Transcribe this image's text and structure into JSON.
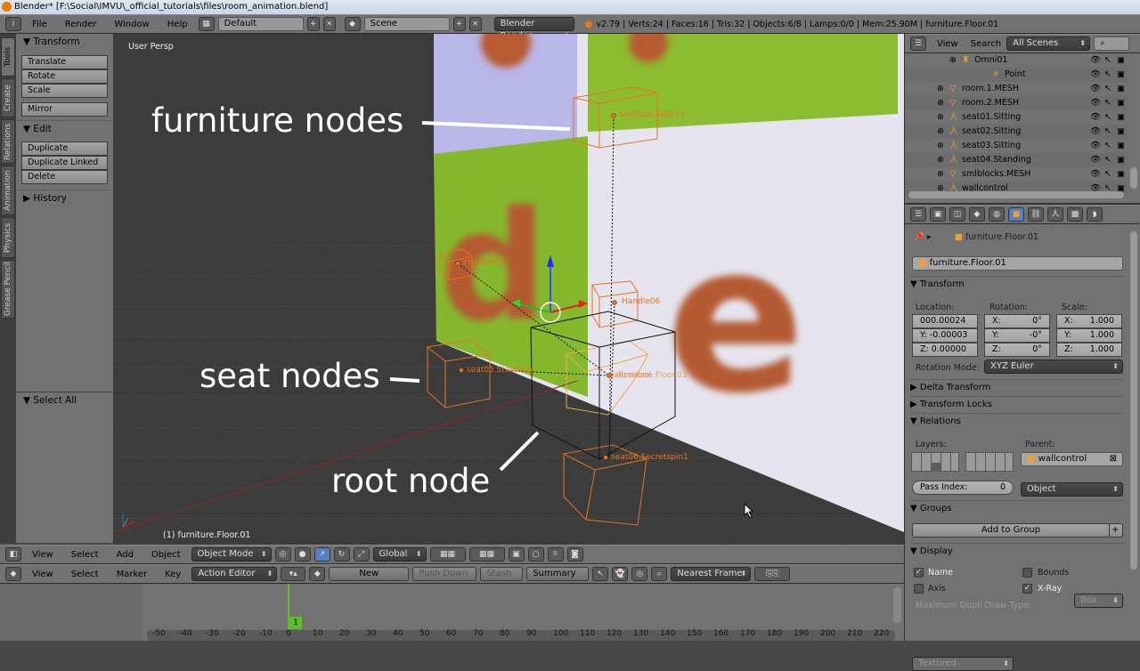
{
  "window": {
    "title": "Blender* [F:\\Social\\IMVU\\_official_tutorials\\files\\room_animation.blend]"
  },
  "info_header": {
    "menus": [
      "File",
      "Render",
      "Window",
      "Help"
    ],
    "layout": "Default",
    "scene": "Scene",
    "engine": "Blender Render",
    "stats": "v2.79 | Verts:24 | Faces:16 | Tris:32 | Objects:6/8 | Lamps:0/0 | Mem:25.90M | furniture.Floor.01"
  },
  "left_tabs": [
    "Tools",
    "Create",
    "Relations",
    "Animation",
    "Physics",
    "Grease Pencil"
  ],
  "tool_panel": {
    "transform_title": "Transform",
    "transform_buttons": [
      "Translate",
      "Rotate",
      "Scale"
    ],
    "mirror": "Mirror",
    "edit_title": "Edit",
    "edit_buttons": [
      "Duplicate",
      "Duplicate Linked",
      "Delete"
    ],
    "history_title": "History",
    "operator": "Select All"
  },
  "viewport": {
    "view_name": "User Persp",
    "active_object": "(1) furniture.Floor.01",
    "object_labels": [
      "furniture.Wall.11",
      "Handle05",
      "Handle06",
      "seat05.Standing",
      "wallcontrol",
      "furniture.Floor.01",
      "seat06.Secretspin1"
    ],
    "annotations": [
      "furniture nodes",
      "seat nodes",
      "root node"
    ]
  },
  "viewport_header": {
    "menus": [
      "View",
      "Select",
      "Add",
      "Object"
    ],
    "mode": "Object Mode",
    "orientation": "Global"
  },
  "timeline_header": {
    "menus": [
      "View",
      "Select",
      "Marker",
      "Key"
    ],
    "editor": "Action Editor",
    "new": "New",
    "push_down": "Push Down",
    "stash": "Stash",
    "summary": "Summary",
    "snap": "Nearest Frame"
  },
  "timeline": {
    "current_frame": "1",
    "ticks": [
      "-50",
      "-40",
      "-30",
      "-20",
      "-10",
      "0",
      "10",
      "20",
      "30",
      "40",
      "50",
      "60",
      "70",
      "80",
      "90",
      "100",
      "110",
      "120",
      "130",
      "140",
      "150",
      "160",
      "170",
      "180",
      "190",
      "200",
      "210",
      "220"
    ]
  },
  "outliner": {
    "menus": [
      "View",
      "Search"
    ],
    "filter": "All Scenes",
    "rows": [
      {
        "name": "Omni01",
        "type": "lamp"
      },
      {
        "name": "Point",
        "type": "lamp-data"
      },
      {
        "name": "room.1.MESH",
        "type": "mesh"
      },
      {
        "name": "room.2.MESH",
        "type": "mesh"
      },
      {
        "name": "seat01.Sitting",
        "type": "empty"
      },
      {
        "name": "seat02.Sitting",
        "type": "empty"
      },
      {
        "name": "seat03.Sitting",
        "type": "empty"
      },
      {
        "name": "seat04.Standing",
        "type": "empty"
      },
      {
        "name": "smlblocks.MESH",
        "type": "mesh"
      },
      {
        "name": "wallcontrol",
        "type": "empty"
      }
    ]
  },
  "properties": {
    "breadcrumb": "furniture.Floor.01",
    "object_name": "furniture.Floor.01",
    "transform": {
      "title": "Transform",
      "location_label": "Location:",
      "rotation_label": "Rotation:",
      "scale_label": "Scale:",
      "location": [
        "000.00024",
        "Y:  -0.00003",
        "Z:  0.00000"
      ],
      "rotation": [
        [
          "X:",
          "0°"
        ],
        [
          "Y:",
          "-0°"
        ],
        [
          "Z:",
          "0°"
        ]
      ],
      "scale": [
        [
          "X:",
          "1.000"
        ],
        [
          "Y:",
          "1.000"
        ],
        [
          "Z:",
          "1.000"
        ]
      ],
      "rotation_mode_label": "Rotation Mode:",
      "rotation_mode": "XYZ Euler"
    },
    "delta_transform": "Delta Transform",
    "transform_locks": "Transform Locks",
    "relations": {
      "title": "Relations",
      "layers_label": "Layers:",
      "parent_label": "Parent:",
      "parent": "wallcontrol",
      "parent_type": "Object",
      "pass_index_label": "Pass Index:",
      "pass_index": "0"
    },
    "groups": {
      "title": "Groups",
      "add": "Add to Group"
    },
    "display": {
      "title": "Display",
      "name": "Name",
      "name_checked": true,
      "axis": "Axis",
      "axis_checked": false,
      "bounds": "Bounds",
      "bounds_checked": false,
      "bounds_type": "Box",
      "xray": "X-Ray",
      "xray_checked": true,
      "dupli_label": "Maximum Dupli Draw Type:",
      "dupli_value": "Textured"
    }
  },
  "colors": {
    "accent_orange": "#e8731f",
    "selected_blue": "#5680c2",
    "keyframe_green": "#5fbd2c"
  }
}
